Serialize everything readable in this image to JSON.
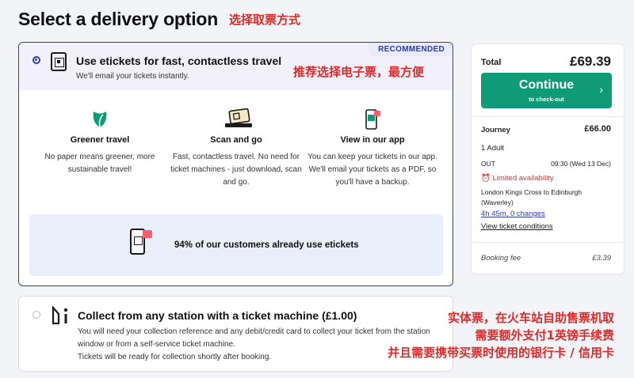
{
  "page": {
    "title": "Select a delivery option",
    "annotation_title": "选择取票方式"
  },
  "etickets": {
    "title": "Use etickets for fast, contactless travel",
    "subtitle": "We'll email your tickets instantly.",
    "badge": "RECOMMENDED",
    "annotation": "推荐选择电子票，最方便",
    "features": [
      {
        "icon": "leaf-icon",
        "title": "Greener travel",
        "desc": "No paper means greener, more sustainable travel!"
      },
      {
        "icon": "scan-ticket-icon",
        "title": "Scan and go",
        "desc": "Fast, contactless travel. No need for ticket machines - just download, scan and go."
      },
      {
        "icon": "phone-app-icon",
        "title": "View in our app",
        "desc": "You can keep your tickets in our app. We'll email your tickets as a PDF, so you'll have a backup."
      }
    ],
    "banner": "94% of our customers already use etickets"
  },
  "collect": {
    "title": "Collect from any station with a ticket machine (£1.00)",
    "desc1": "You will need your collection reference and any debit/credit card to collect your ticket from the station window or from a self-service ticket machine.",
    "desc2": "Tickets will be ready for collection shortly after booking.",
    "annotation": [
      "实体票，在火车站自助售票机取",
      "需要额外支付1英镑手续费",
      "并且需要携带买票时使用的银行卡 / 信用卡"
    ]
  },
  "summary": {
    "total_label": "Total",
    "total_value": "£69.39",
    "continue_label": "Continue",
    "continue_sub": "to check-out",
    "journey_label": "Journey",
    "journey_value": "£66.00",
    "passengers": "1 Adult",
    "direction": "OUT",
    "datetime": "09:30 (Wed 13 Dec)",
    "availability": "Limited availability",
    "route": "London Kings Cross to Edinburgh (Waverley)",
    "duration": "4h 45m",
    "changes": "0 changes",
    "conditions": "View ticket conditions",
    "fee_label": "Booking fee",
    "fee_value": "£3.39"
  },
  "colors": {
    "accent": "#2d3aa8",
    "continue": "#0f9b78",
    "annotation": "#e02a2a",
    "limited": "#d0342c"
  }
}
